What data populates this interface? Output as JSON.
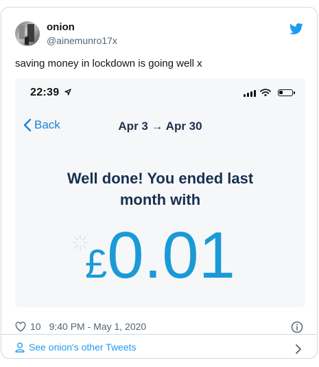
{
  "tweet": {
    "author_name": "onion",
    "author_handle": "@ainemunro17x",
    "text": "saving money in lockdown is going well x",
    "likes": "10",
    "timestamp": "9:40 PM - May 1, 2020"
  },
  "attached_screenshot": {
    "status_bar_time": "22:39",
    "back_label": "Back",
    "date_range": "Apr 3 → Apr 30",
    "headline_line1": "Well done! You ended last",
    "headline_line2": "month with",
    "currency_symbol": "£",
    "amount": "0.01"
  },
  "footer": {
    "link_text": "See onion's other Tweets"
  },
  "colors": {
    "twitter_blue": "#1d9bf0",
    "amount_blue": "#1a9ad6",
    "headline_navy": "#16304f"
  },
  "icons": [
    "twitter-bird-icon",
    "heart-icon",
    "info-icon",
    "person-icon",
    "chevron-right-icon",
    "chevron-left-icon",
    "location-arrow-icon",
    "signal-icon",
    "wifi-icon",
    "battery-icon"
  ]
}
